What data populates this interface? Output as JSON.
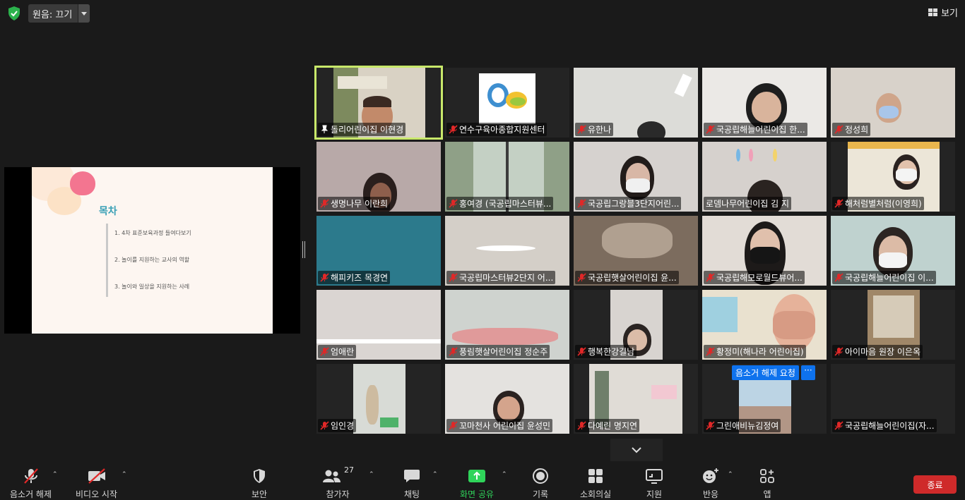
{
  "topbar": {
    "audio_label": "원음: 끄기",
    "view_label": "보기"
  },
  "slide": {
    "title": "목차",
    "items": [
      "1. 4차 표준보육과정 들여다보기",
      "2. 놀이를 지원하는 교사의 역할",
      "3. 놀이와 일상을 지원하는 사례"
    ]
  },
  "participants": [
    {
      "name": "돌리어린이집 이현경",
      "pinned": true
    },
    {
      "name": "연수구육아종합지원센터",
      "muted": true
    },
    {
      "name": "유한나",
      "muted": true
    },
    {
      "name": "국공립해늘어린이집 한...",
      "muted": true
    },
    {
      "name": "정성희",
      "muted": true
    },
    {
      "name": "생명나무 이란희",
      "muted": true
    },
    {
      "name": "홍여경 (국공립마스터뷰...",
      "muted": true
    },
    {
      "name": "국공립그랑블3단지어린...",
      "muted": true
    },
    {
      "name": "로뎀나무어린이집 김 지",
      "muted": false
    },
    {
      "name": "해처럼별처럼(이영희)",
      "muted": true
    },
    {
      "name": "해피키즈 목경연",
      "muted": true
    },
    {
      "name": "국공립마스터뷰2단지 어...",
      "muted": true
    },
    {
      "name": "국공립햇살어린이집 윤...",
      "muted": true
    },
    {
      "name": "국공립해모로월드뷰어...",
      "muted": true
    },
    {
      "name": "국공립해늘어린이집  이...",
      "muted": true
    },
    {
      "name": "엄애란",
      "muted": true
    },
    {
      "name": "풍림햇살어린이집 정순주",
      "muted": true
    },
    {
      "name": "행복한강길남",
      "muted": true
    },
    {
      "name": "황정미(해나라 어린이집)",
      "muted": true
    },
    {
      "name": "아이마음 원장 이은옥",
      "muted": true
    },
    {
      "name": "임인경",
      "muted": true
    },
    {
      "name": "꼬마천사 어린이집 윤성민",
      "muted": true
    },
    {
      "name": "다예린  명지연",
      "muted": true
    },
    {
      "name": "그린애비뉴김정여",
      "muted": true
    },
    {
      "name": "국공립해늘어린이집(자...",
      "muted": true
    }
  ],
  "unmute_request": {
    "label": "음소거 해제 요청",
    "more": "···"
  },
  "toolbar": {
    "unmute": "음소거 해제",
    "video": "비디오 시작",
    "security": "보안",
    "participants": "참가자",
    "participant_count": "27",
    "chat": "채팅",
    "share": "화면 공유",
    "record": "기록",
    "breakout": "소회의실",
    "support": "지원",
    "reactions": "반응",
    "apps": "앱",
    "end": "종료"
  },
  "colors": {
    "active_speaker": "#c8e86a",
    "share_green": "#2fd45a",
    "end_red": "#cf2a2a",
    "mute_red": "#e02828",
    "accent_blue": "#0e72ed"
  }
}
